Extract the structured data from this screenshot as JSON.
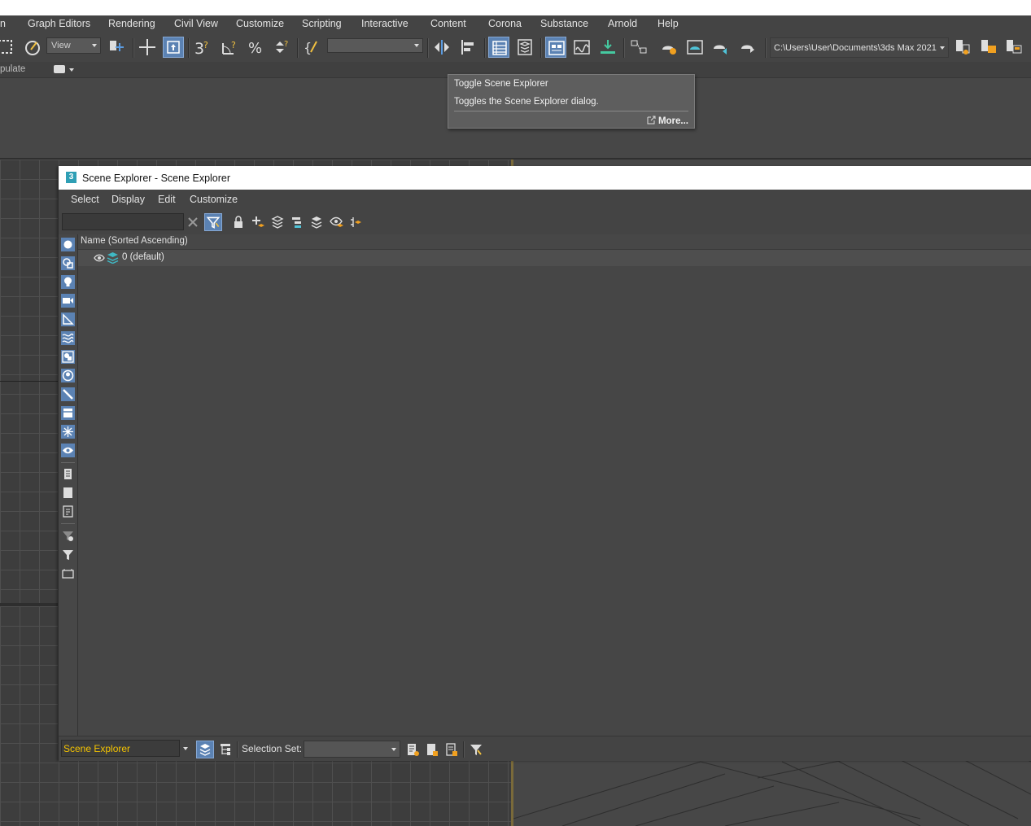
{
  "menubar": {
    "items": [
      "n",
      "Graph Editors",
      "Rendering",
      "Civil View",
      "Customize",
      "Scripting",
      "Interactive",
      "Content",
      "Corona",
      "Substance",
      "Arnold",
      "Help"
    ]
  },
  "toolbar": {
    "view_combo": "View",
    "named_selection_combo": "",
    "project_path": "C:\\Users\\User\\Documents\\3ds Max 2021"
  },
  "row2": {
    "label": "pulate"
  },
  "tooltip": {
    "title": "Toggle Scene Explorer",
    "description": "Toggles the Scene Explorer dialog.",
    "more": "More..."
  },
  "scene_explorer": {
    "window_title": "Scene Explorer - Scene Explorer",
    "menu": [
      "Select",
      "Display",
      "Edit",
      "Customize"
    ],
    "search_value": "",
    "column_header": "Name (Sorted Ascending)",
    "rows": [
      {
        "label": "0 (default)"
      }
    ],
    "explorer_name": "Scene Explorer",
    "selection_set_label": "Selection Set:",
    "selection_set_value": ""
  },
  "colors": {
    "accent": "#5b82b3",
    "layer_icon": "#3fb8c4",
    "explorer_name_text": "#f5c400",
    "viewport_bg": "#3d3d3d"
  }
}
